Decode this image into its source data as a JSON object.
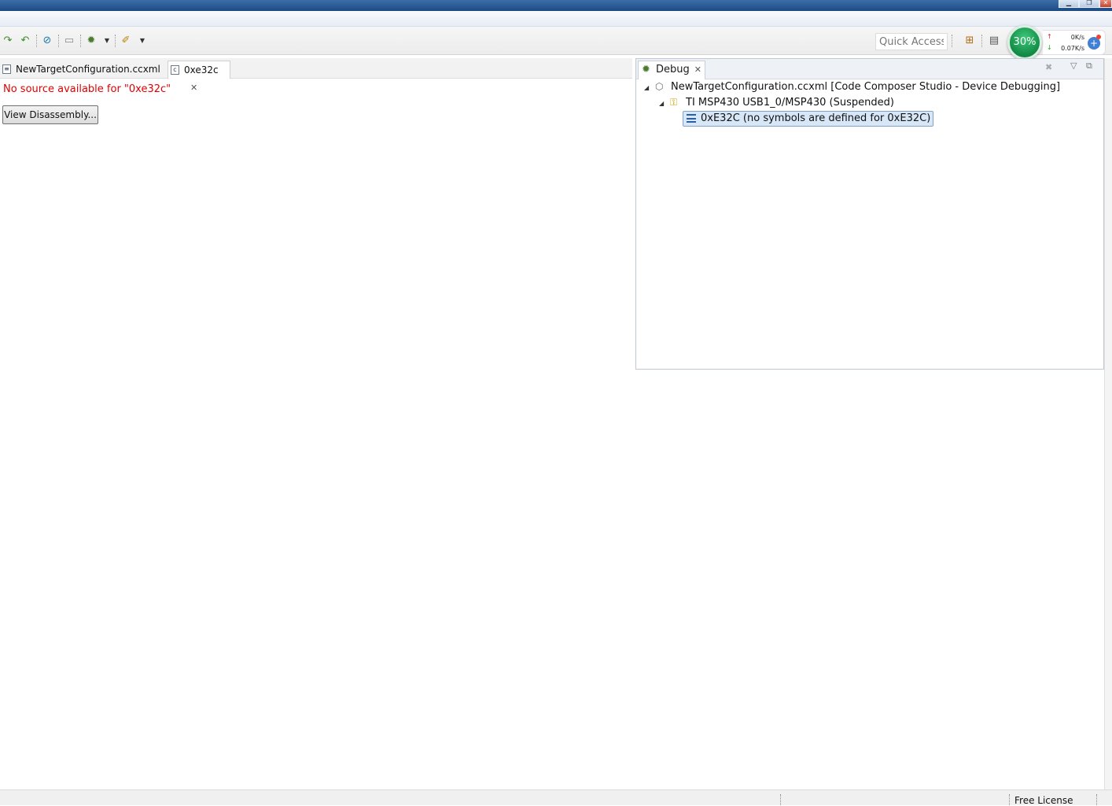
{
  "toolbar": {
    "icons": [
      "step-over-icon",
      "step-return-icon",
      "connect-icon",
      "terminal-icon",
      "debug-icon",
      "run-icon"
    ],
    "quick_access_placeholder": "Quick Access"
  },
  "widget": {
    "progress_label": "30%",
    "upload_speed": "0K/s",
    "download_speed": "0.07K/s"
  },
  "editor": {
    "tabs": [
      {
        "label": "NewTargetConfiguration.ccxml",
        "active": false
      },
      {
        "label": "0xe32c",
        "active": true
      }
    ],
    "message": "No source available for \"0xe32c\"",
    "view_disassembly_label": "View Disassembly..."
  },
  "debug_view": {
    "tab_label": "Debug",
    "tree": [
      {
        "label": "NewTargetConfiguration.ccxml [Code Composer Studio - Device Debugging]",
        "level": 0
      },
      {
        "label": "TI MSP430 USB1_0/MSP430 (Suspended)",
        "level": 1
      },
      {
        "label": "0xE32C  (no symbols are defined for 0xE32C)",
        "level": 2,
        "selected": true
      }
    ]
  },
  "status": {
    "license": "Free License"
  }
}
